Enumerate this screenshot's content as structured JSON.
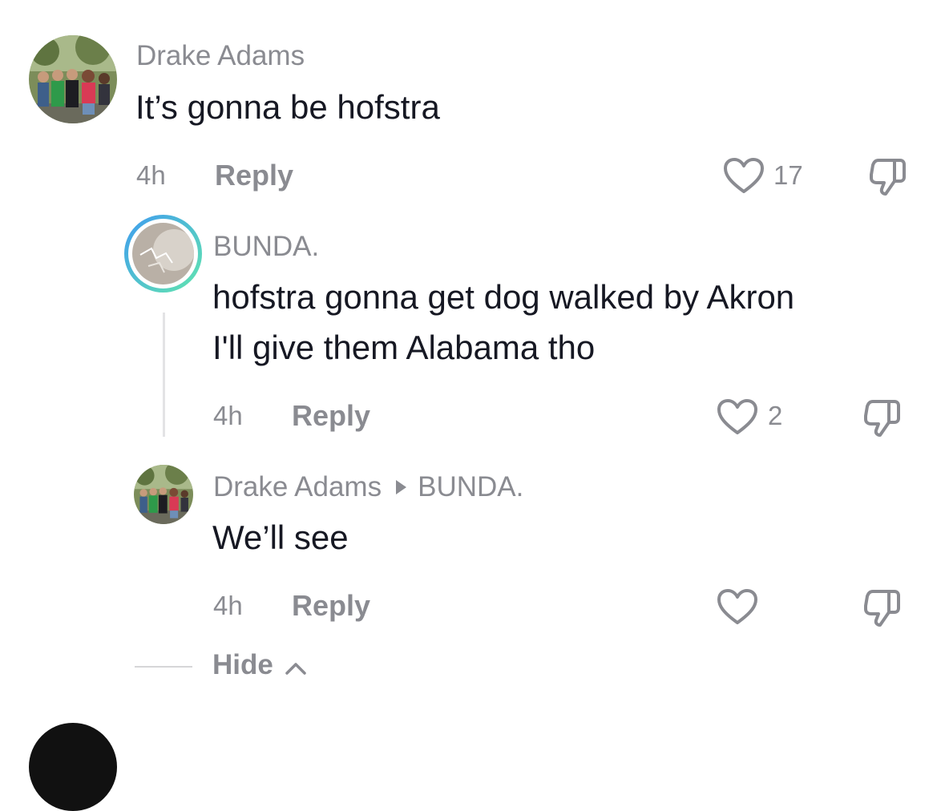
{
  "comments": [
    {
      "username": "Drake Adams",
      "text": "It’s gonna be hofstra",
      "time": "4h",
      "reply_label": "Reply",
      "likes": "17"
    },
    {
      "username": "BUNDA.",
      "text_line1": "hofstra gonna get dog walked by Akron",
      "text_line2": "I'll give them Alabama tho",
      "time": "4h",
      "reply_label": "Reply",
      "likes": "2"
    },
    {
      "username": "Drake Adams",
      "reply_to": "BUNDA.",
      "text": "We’ll see",
      "time": "4h",
      "reply_label": "Reply",
      "likes": ""
    }
  ],
  "hide_label": "Hide",
  "icons": [
    "heart-icon",
    "thumbs-down-icon",
    "chevron-up-icon",
    "reply-arrow-icon"
  ],
  "colors": {
    "text": "#161823",
    "secondary": "#8a8b91",
    "ring_start": "#4fa8f0",
    "ring_end": "#5ee5b0"
  }
}
